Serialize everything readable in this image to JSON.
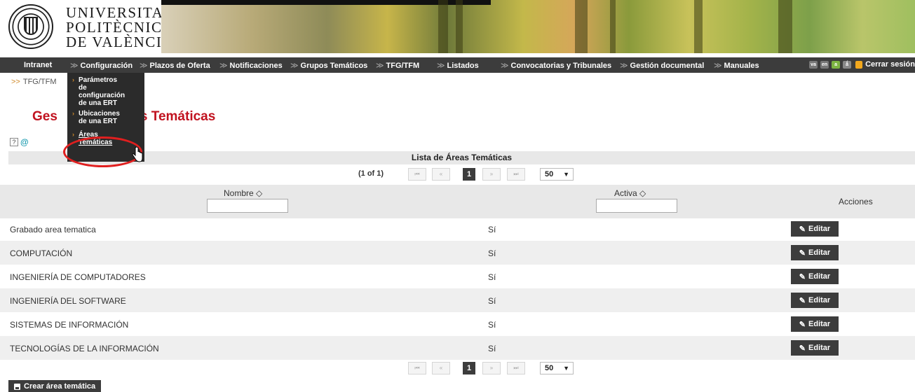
{
  "header": {
    "logo_lines": [
      "UNIVERSITAT",
      "POLITÈCNICA",
      "DE VALÈNCIA"
    ]
  },
  "nav": {
    "items": [
      {
        "label": "Intranet",
        "chevron": false
      },
      {
        "label": "Configuración",
        "chevron": true
      },
      {
        "label": "Plazos de Oferta",
        "chevron": true
      },
      {
        "label": "Notificaciones",
        "chevron": true
      },
      {
        "label": "Grupos Temáticos",
        "chevron": true
      },
      {
        "label": "TFG/TFM",
        "chevron": true
      },
      {
        "label": "Listados",
        "chevron": true
      },
      {
        "label": "Convocatorias y Tribunales",
        "chevron": true
      },
      {
        "label": "Gestión documental",
        "chevron": true
      },
      {
        "label": "Manuales",
        "chevron": true
      }
    ],
    "languages": [
      "va",
      "en",
      "a",
      "ǻ"
    ],
    "logout_label": "Cerrar sesión"
  },
  "breadcrumb": {
    "label": "TFG/TFM"
  },
  "dropdown": {
    "items": [
      {
        "label_lines": [
          "Parámetros",
          "de",
          "configuración",
          "de una ERT"
        ]
      },
      {
        "label_lines": [
          "Ubicaciones",
          "de una ERT"
        ]
      },
      {
        "label_lines": [
          "Áreas",
          "Temáticas"
        ]
      }
    ]
  },
  "page": {
    "title_left": "Ges",
    "title_right": "s Temáticas"
  },
  "table": {
    "caption": "Lista de Áreas Temáticas",
    "paginator": {
      "info": "(1 of 1)",
      "page": "1",
      "rows_per_page": "50",
      "first": "⏮",
      "prev": "«",
      "next": "»",
      "last": "⏭"
    },
    "columns": {
      "name": "Nombre ◇",
      "active": "Activa ◇",
      "actions": "Acciones"
    },
    "rows": [
      {
        "name": "Grabado area tematica",
        "active": "Sí"
      },
      {
        "name": "COMPUTACIÓN",
        "active": "Sí"
      },
      {
        "name": "INGENIERÍA DE COMPUTADORES",
        "active": "Sí"
      },
      {
        "name": "INGENIERÍA DEL SOFTWARE",
        "active": "Sí"
      },
      {
        "name": "SISTEMAS DE INFORMACIÓN",
        "active": "Sí"
      },
      {
        "name": "TECNOLOGÍAS DE LA INFORMACIÓN",
        "active": "Sí"
      }
    ],
    "edit_label": "Editar"
  },
  "create_label": "Crear área temática",
  "colors": {
    "accent_red": "#c1121f",
    "nav_dark": "#3c3c3c",
    "menu_bullet": "#d08a2a"
  }
}
